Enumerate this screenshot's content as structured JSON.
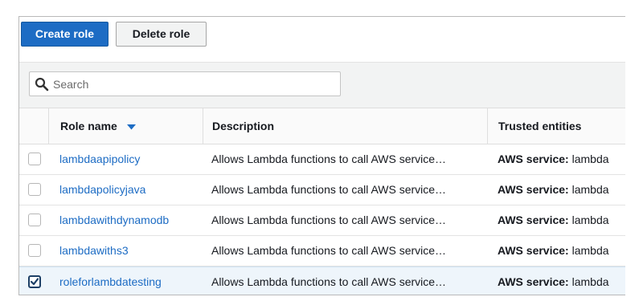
{
  "toolbar": {
    "create_label": "Create role",
    "delete_label": "Delete role"
  },
  "search": {
    "placeholder": "Search"
  },
  "table": {
    "columns": {
      "role_name": "Role name",
      "description": "Description",
      "trusted_entities": "Trusted entities"
    },
    "sort_icon": "caret-down-icon",
    "rows": [
      {
        "name": "lambdaapipolicy",
        "description": "Allows Lambda functions to call AWS service…",
        "trusted_label": "AWS service:",
        "trusted_value": "lambda",
        "checked": false
      },
      {
        "name": "lambdapolicyjava",
        "description": "Allows Lambda functions to call AWS service…",
        "trusted_label": "AWS service:",
        "trusted_value": "lambda",
        "checked": false
      },
      {
        "name": "lambdawithdynamodb",
        "description": "Allows Lambda functions to call AWS service…",
        "trusted_label": "AWS service:",
        "trusted_value": "lambda",
        "checked": false
      },
      {
        "name": "lambdawiths3",
        "description": "Allows Lambda functions to call AWS service…",
        "trusted_label": "AWS service:",
        "trusted_value": "lambda",
        "checked": false
      },
      {
        "name": "roleforlambdatesting",
        "description": "Allows Lambda functions to call AWS service…",
        "trusted_label": "AWS service:",
        "trusted_value": "lambda",
        "checked": true
      }
    ]
  },
  "colors": {
    "primary": "#1d6cc4",
    "link": "#1d6cc4",
    "selected_row": "#eef5fb"
  }
}
